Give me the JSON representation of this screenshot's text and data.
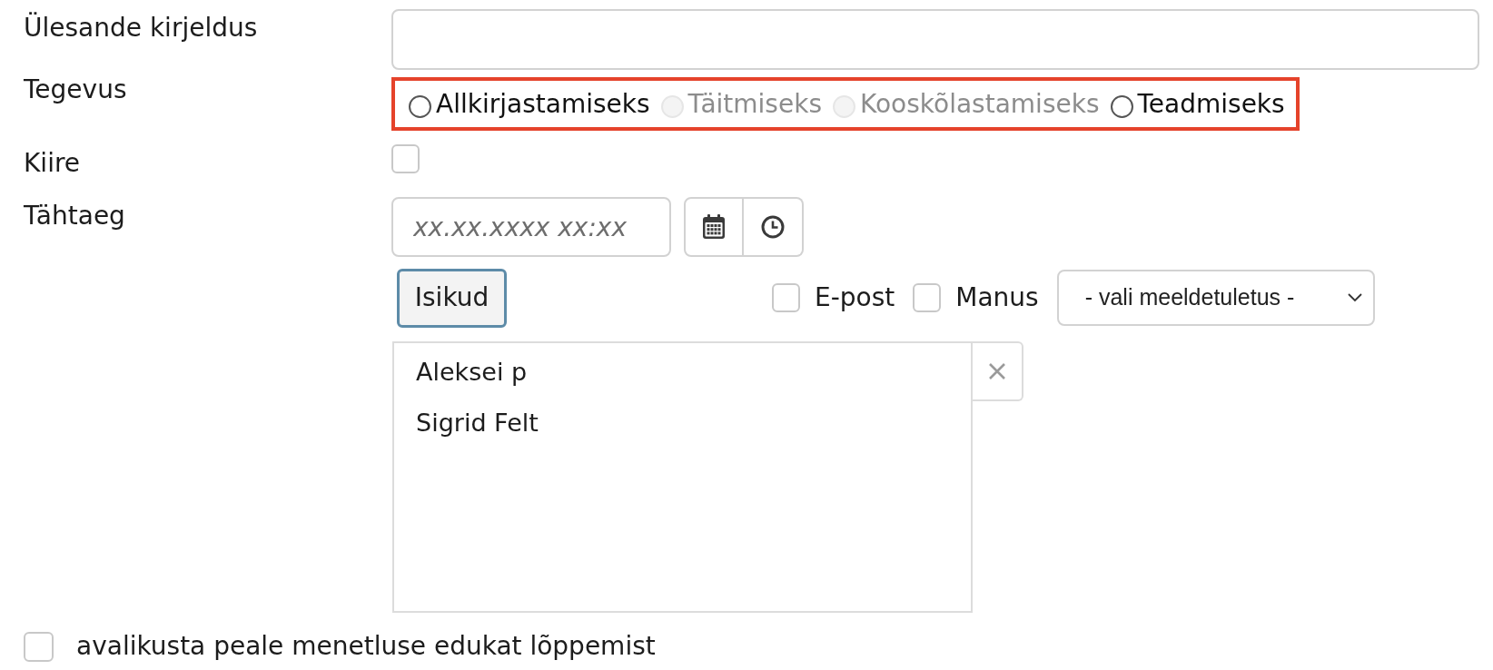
{
  "task_description": {
    "label": "Ülesande kirjeldus"
  },
  "action": {
    "label": "Tegevus",
    "highlighted": true,
    "options": [
      {
        "label": "Allkirjastamiseks",
        "selected": false,
        "disabled": false
      },
      {
        "label": "Täitmiseks",
        "selected": false,
        "disabled": true
      },
      {
        "label": "Kooskõlastamiseks",
        "selected": false,
        "disabled": true
      },
      {
        "label": "Teadmiseks",
        "selected": false,
        "disabled": false
      }
    ]
  },
  "urgent": {
    "label": "Kiire",
    "checked": false
  },
  "deadline": {
    "label": "Tähtaeg",
    "placeholder": "xx.xx.xxxx xx:xx"
  },
  "persons": {
    "button": {
      "label": "Isikud",
      "focused": true
    },
    "email": {
      "label": "E-post",
      "checked": false
    },
    "attachment": {
      "label": "Manus",
      "checked": false
    },
    "reminder": {
      "value": "- vali meeldetuletus -"
    },
    "list": [
      {
        "name": "Aleksei p",
        "selected": false
      },
      {
        "name": "Sigrid Felt",
        "selected": false
      }
    ]
  },
  "publish": {
    "label": "avalikusta peale menetluse edukat lõppemist",
    "checked": false
  }
}
